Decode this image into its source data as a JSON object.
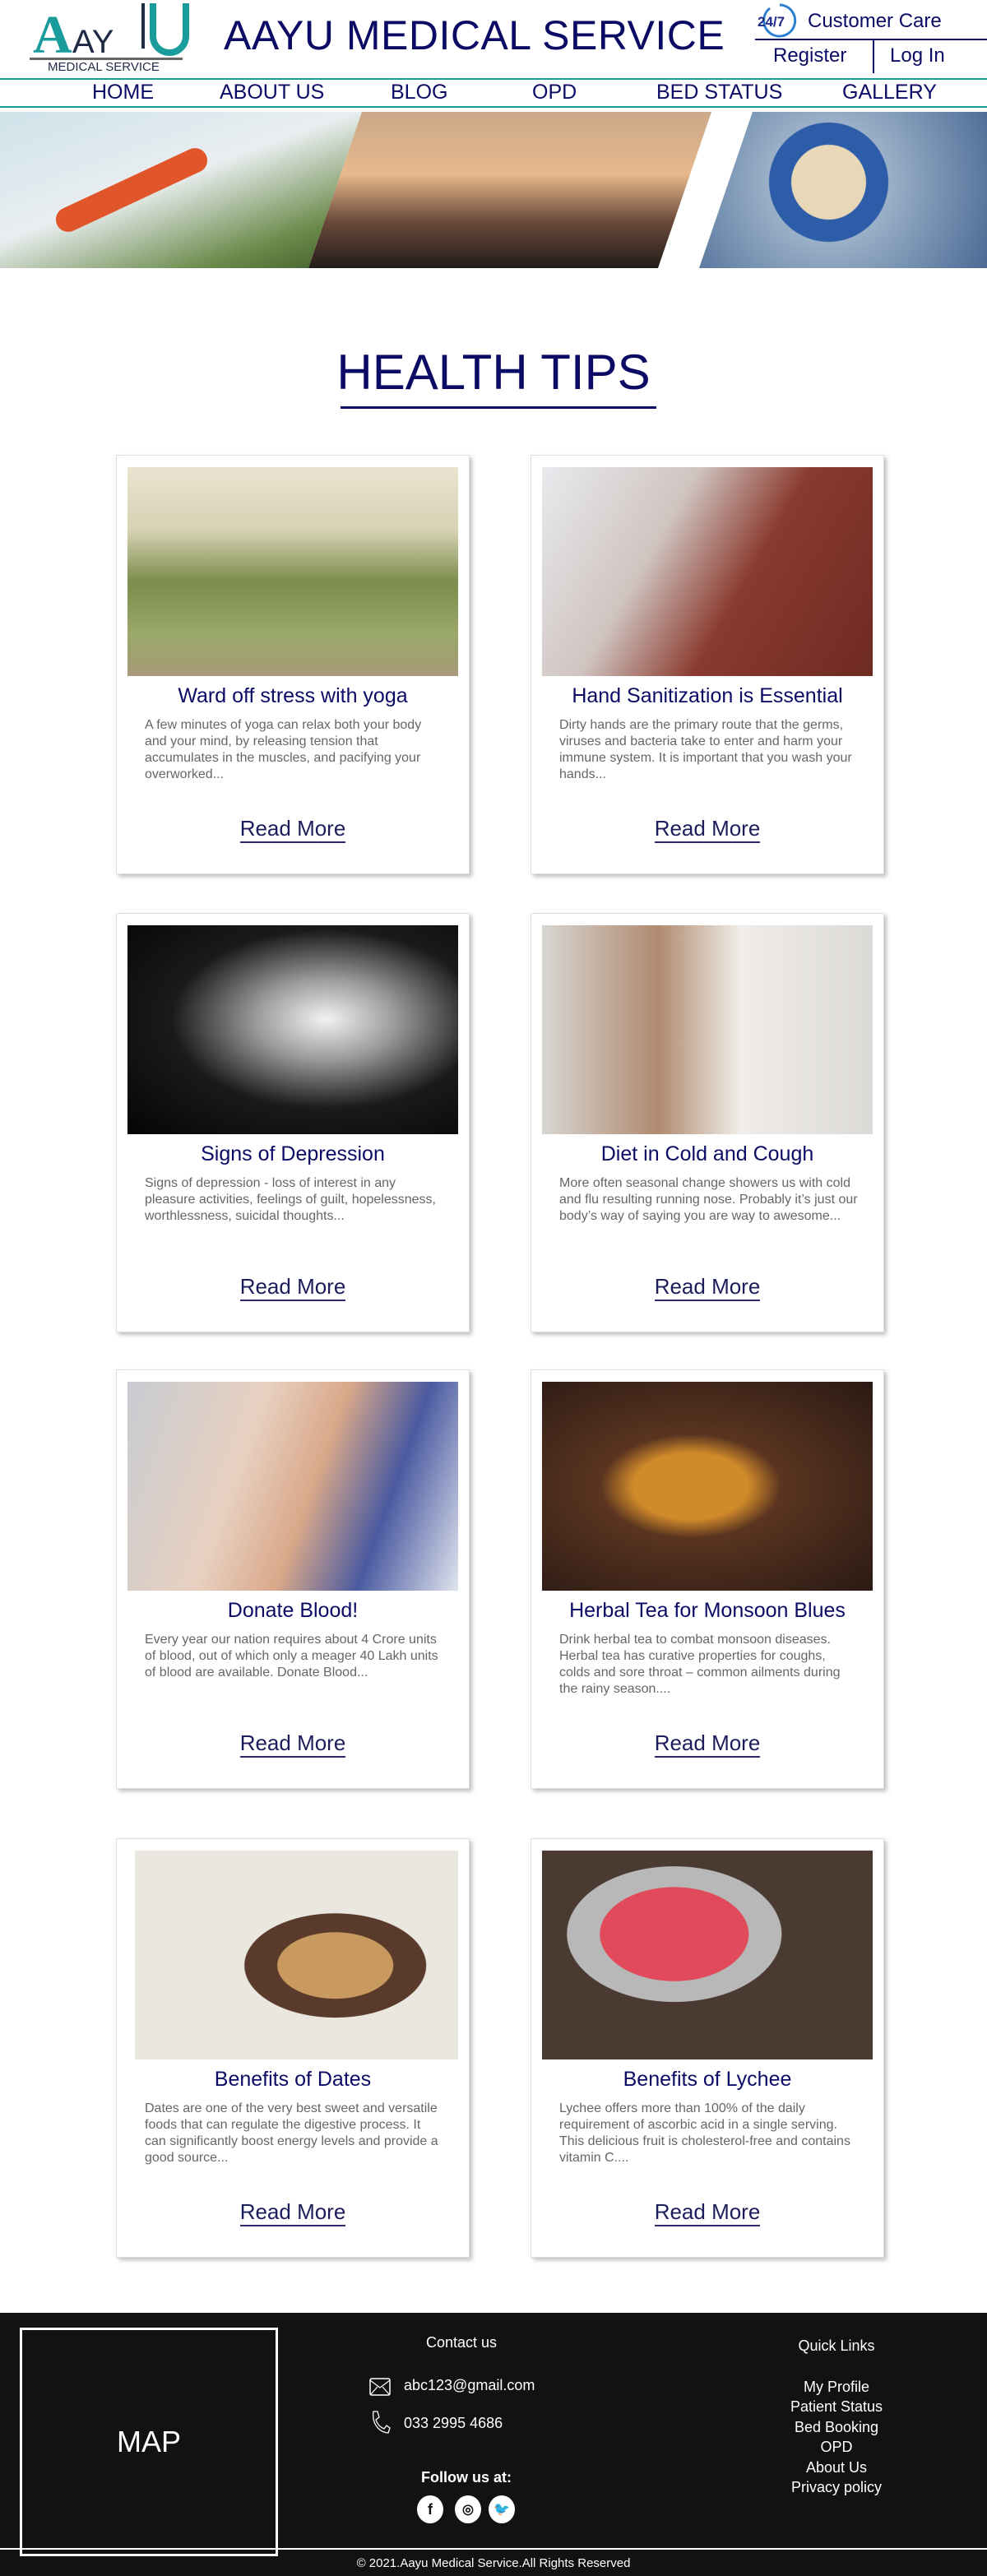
{
  "header": {
    "logo_text": "AAYU",
    "logo_subtitle": "MEDICAL SERVICE",
    "site_title": "AAYU MEDICAL SERVICE",
    "customer_care": "Customer Care",
    "care_badge": "24/7",
    "register": "Register",
    "login": "Log In"
  },
  "nav": [
    "HOME",
    "ABOUT US",
    "BLOG",
    "OPD",
    "BED STATUS",
    "GALLERY"
  ],
  "page_heading": "HEALTH TIPS",
  "read_more": "Read More",
  "cards": [
    {
      "title": "Ward off stress with yoga",
      "text": "A few minutes of yoga can relax both your body and your mind, by releasing tension that accumulates in the muscles, and pacifying your overworked..."
    },
    {
      "title": "Hand Sanitization is Essential",
      "text": "Dirty hands are the primary route that the germs, viruses and bacteria take to enter and harm your immune system. It is important that you wash your hands..."
    },
    {
      "title": "Signs of Depression",
      "text": "Signs of depression - loss of interest in any pleasure activities, feelings of guilt, hopelessness, worthlessness, suicidal thoughts..."
    },
    {
      "title": "Diet in Cold and Cough",
      "text": "More often seasonal change showers us with cold and flu resulting running nose. Probably it’s just our body’s way of saying you are way to awesome..."
    },
    {
      "title": "Donate Blood!",
      "text": "Every year our nation requires about 4 Crore units of blood, out of which only a meager 40 Lakh units of blood are available. Donate Blood..."
    },
    {
      "title": "Herbal Tea for Monsoon Blues",
      "text": "Drink herbal tea to combat monsoon diseases. Herbal tea has curative properties for coughs, colds and sore throat – common ailments during the rainy season...."
    },
    {
      "title": "Benefits of Dates",
      "text": "Dates are one of the very best sweet and versatile foods that can regulate the digestive process. It can significantly boost energy levels and provide a good source..."
    },
    {
      "title": "Benefits of Lychee",
      "text": "Lychee offers more than 100% of the daily requirement of ascorbic acid in a single serving. This delicious fruit is cholesterol-free and contains vitamin C...."
    }
  ],
  "footer": {
    "map": "MAP",
    "contact_heading": "Contact us",
    "email": "abc123@gmail.com",
    "phone": "033 2995 4686",
    "follow": "Follow us at:",
    "quick_heading": "Quick Links",
    "quick_links": [
      "My Profile",
      "Patient Status",
      "Bed Booking",
      "OPD",
      "About Us",
      "Privacy policy"
    ],
    "copyright": "© 2021.Aayu Medical Service.All Rights Reserved"
  },
  "colors": {
    "navy": "#0b0b66",
    "teal": "#1a9c9c",
    "footer": "#121212"
  }
}
